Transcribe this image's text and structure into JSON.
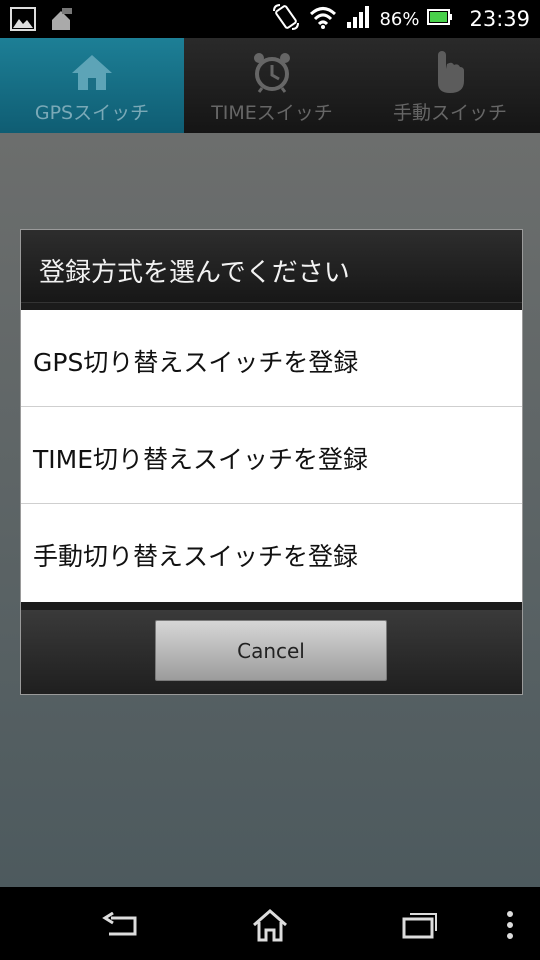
{
  "status_bar": {
    "battery_percent": "86%",
    "clock": "23:39",
    "icons": [
      "gallery-icon",
      "app-notification-icon",
      "rotate-icon",
      "wifi-icon",
      "signal-icon",
      "battery-icon"
    ]
  },
  "tabs": [
    {
      "label": "GPSスイッチ",
      "icon": "home-icon",
      "active": true
    },
    {
      "label": "TIMEスイッチ",
      "icon": "alarm-clock-icon",
      "active": false
    },
    {
      "label": "手動スイッチ",
      "icon": "hand-pointer-icon",
      "active": false
    }
  ],
  "dialog": {
    "title": "登録方式を選んでください",
    "options": [
      {
        "label": "GPS切り替えスイッチを登録"
      },
      {
        "label": "TIME切り替えスイッチを登録"
      },
      {
        "label": "手動切り替えスイッチを登録"
      }
    ],
    "cancel_label": "Cancel"
  },
  "nav_bar": {
    "buttons": [
      "back-icon",
      "home-icon",
      "recent-apps-icon",
      "menu-icon"
    ]
  },
  "colors": {
    "active_tab": "#1d7f96",
    "dim_overlay": "#5a6263",
    "dialog_bg": "#ffffff"
  }
}
